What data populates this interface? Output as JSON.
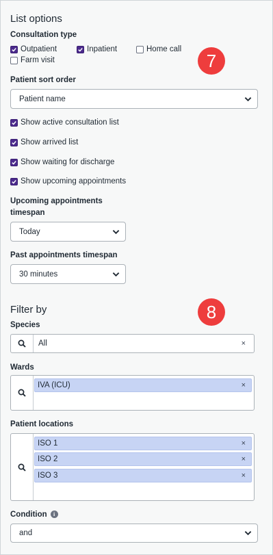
{
  "list_options": {
    "title": "List options",
    "consultation_type": {
      "label": "Consultation type",
      "options": [
        {
          "label": "Outpatient",
          "checked": true
        },
        {
          "label": "Inpatient",
          "checked": true
        },
        {
          "label": "Home call",
          "checked": false
        },
        {
          "label": "Farm visit",
          "checked": false
        }
      ]
    },
    "patient_sort_order": {
      "label": "Patient sort order",
      "value": "Patient name"
    },
    "toggles": [
      {
        "label": "Show active consultation list",
        "checked": true
      },
      {
        "label": "Show arrived list",
        "checked": true
      },
      {
        "label": "Show waiting for discharge",
        "checked": true
      },
      {
        "label": "Show upcoming appointments",
        "checked": true
      }
    ],
    "upcoming_timespan": {
      "label_line1": "Upcoming appointments",
      "label_line2": "timespan",
      "value": "Today"
    },
    "past_timespan": {
      "label": "Past appointments timespan",
      "value": "30 minutes"
    }
  },
  "filter_by": {
    "title": "Filter by",
    "species": {
      "label": "Species",
      "value": "All",
      "clear": "×"
    },
    "wards": {
      "label": "Wards",
      "tags": [
        {
          "label": "IVA (ICU)",
          "remove": "×"
        }
      ]
    },
    "patient_locations": {
      "label": "Patient locations",
      "tags": [
        {
          "label": "ISO 1",
          "remove": "×"
        },
        {
          "label": "ISO 2",
          "remove": "×"
        },
        {
          "label": "ISO 3",
          "remove": "×"
        }
      ]
    },
    "condition": {
      "label": "Condition",
      "info_icon": "info-icon",
      "value": "and"
    }
  },
  "badges": {
    "first": "7",
    "second": "8"
  },
  "colors": {
    "checkbox_checked": "#4b2a8c",
    "tag_bg": "#c7d4f4",
    "badge_bg": "#ee3d3d"
  }
}
